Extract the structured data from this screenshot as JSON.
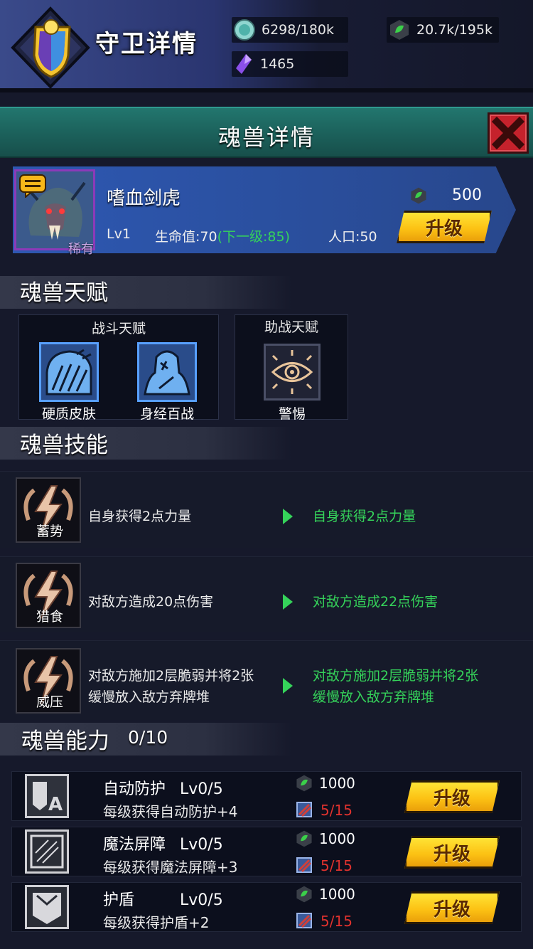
{
  "header": {
    "title": "守卫详情",
    "resources": {
      "crystal": "6298/180k",
      "leaf": "20.7k/195k",
      "gem": "1465"
    }
  },
  "detail": {
    "title": "魂兽详情"
  },
  "beast": {
    "name": "嗜血剑虎",
    "rarity": "稀有",
    "level": "Lv1",
    "hp_label": "生命值:70",
    "hp_next": "(下一级:85)",
    "population": "人口:50",
    "upgrade_cost": "500",
    "upgrade_label": "升级"
  },
  "talents": {
    "title": "魂兽天赋",
    "combat": {
      "title": "战斗天赋",
      "items": [
        {
          "name": "硬质皮肤",
          "icon": "armor-icon"
        },
        {
          "name": "身经百战",
          "icon": "veteran-icon"
        }
      ]
    },
    "support": {
      "title": "助战天赋",
      "items": [
        {
          "name": "警惕",
          "icon": "eye-icon"
        }
      ]
    }
  },
  "skills": {
    "title": "魂兽技能",
    "items": [
      {
        "name": "蓄势",
        "current": [
          "自身获得2点力量"
        ],
        "next": [
          "自身获得2点力量"
        ]
      },
      {
        "name": "猎食",
        "current": [
          "对敌方造成20点伤害"
        ],
        "next": [
          "对敌方造成22点伤害"
        ]
      },
      {
        "name": "威压",
        "current": [
          "对敌方施加2层脆弱并将2张",
          "缓慢放入敌方弃牌堆"
        ],
        "next": [
          "对敌方施加2层脆弱并将2张",
          "缓慢放入敌方弃牌堆"
        ]
      }
    ]
  },
  "abilities": {
    "title": "魂兽能力",
    "progress": "0/10",
    "items": [
      {
        "name": "自动防护",
        "level": "Lv0/5",
        "desc": "每级获得自动防护+4",
        "cost": "1000",
        "count": "5/15",
        "upgrade": "升级",
        "icon": "auto-defense-icon"
      },
      {
        "name": "魔法屏障",
        "level": "Lv0/5",
        "desc": "每级获得魔法屏障+3",
        "cost": "1000",
        "count": "5/15",
        "upgrade": "升级",
        "icon": "magic-barrier-icon"
      },
      {
        "name": "护盾",
        "level": "Lv0/5",
        "desc": "每级获得护盾+2",
        "cost": "1000",
        "count": "5/15",
        "upgrade": "升级",
        "icon": "shield-icon"
      }
    ]
  },
  "colors": {
    "accent_green": "#35d35a",
    "upgrade_yellow": "#fcc214",
    "close_red": "#c5222c",
    "count_red": "#e0322e",
    "banner_teal": "#1c625c",
    "card_blue": "#2e58b2"
  }
}
